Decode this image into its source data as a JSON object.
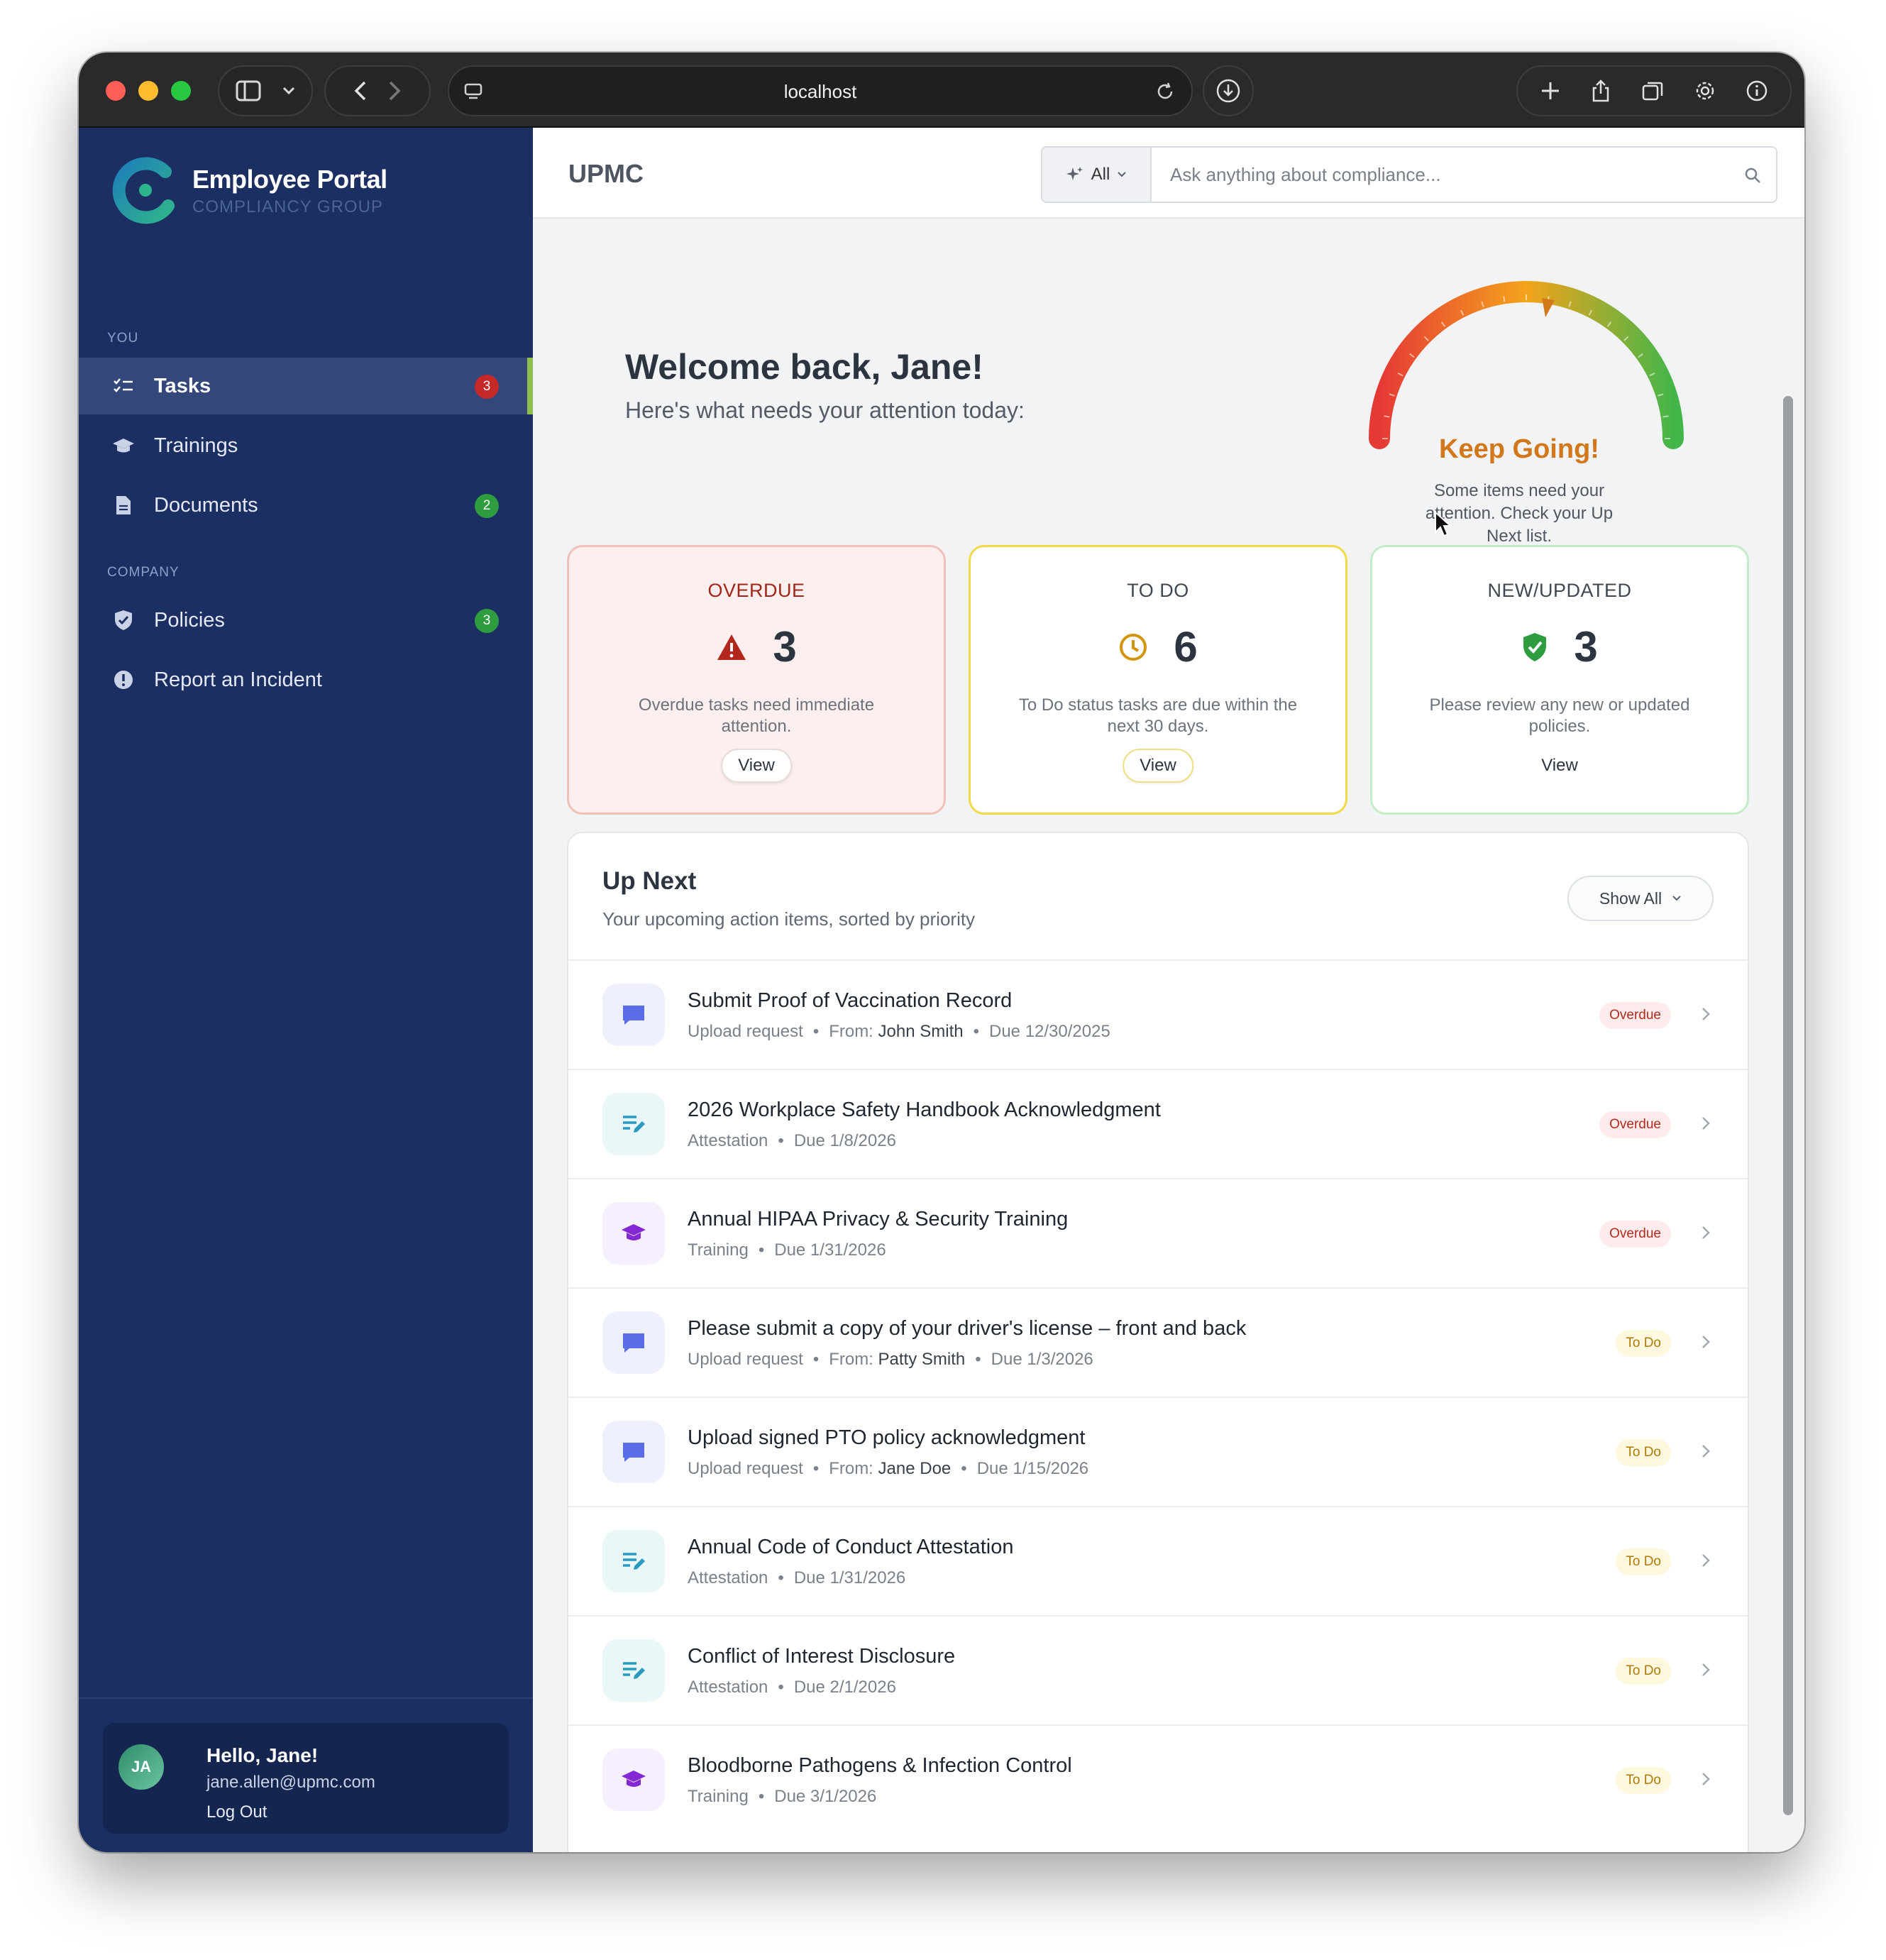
{
  "browser": {
    "url": "localhost"
  },
  "sidebar": {
    "brand_title": "Employee Portal",
    "brand_subtitle": "COMPLIANCY GROUP",
    "section_you": "YOU",
    "section_company": "COMPANY",
    "items": [
      {
        "label": "Tasks",
        "icon": "task-list-icon",
        "badge": "3",
        "active": true
      },
      {
        "label": "Trainings",
        "icon": "graduation-cap-icon",
        "badge": ""
      },
      {
        "label": "Documents",
        "icon": "document-icon",
        "badge": "2"
      },
      {
        "label": "Policies",
        "icon": "shield-check-icon",
        "badge": "3"
      },
      {
        "label": "Report an Incident",
        "icon": "exclamation-circle-icon",
        "badge": ""
      }
    ],
    "user": {
      "initials": "JA",
      "greeting": "Hello, Jane!",
      "email": "jane.allen@upmc.com",
      "logout_label": "Log Out"
    }
  },
  "header": {
    "org_name": "UPMC",
    "search_scope": "All",
    "search_placeholder": "Ask anything about compliance..."
  },
  "welcome": {
    "title": "Welcome back, Jane!",
    "subtitle": "Here's what needs your attention today:"
  },
  "gauge": {
    "title": "Keep Going!",
    "message": "Some items need your attention. Check your Up Next list.",
    "level": 0.55,
    "colors": [
      "#e53935",
      "#f4a31b",
      "#43b649"
    ]
  },
  "stats": [
    {
      "label": "OVERDUE",
      "count": "3",
      "icon": "warning-triangle-icon",
      "description": "Overdue tasks need immediate attention.",
      "view_label": "View",
      "color": "#b3261e"
    },
    {
      "label": "TO DO",
      "count": "6",
      "icon": "clock-icon",
      "description": "To Do status tasks are due within the next 30 days.",
      "view_label": "View",
      "color": "#d1940a"
    },
    {
      "label": "NEW/UPDATED",
      "count": "3",
      "icon": "shield-check-icon",
      "description": "Please review any new or updated policies.",
      "view_label": "View",
      "color": "#2e9c3f"
    }
  ],
  "upnext": {
    "title": "Up Next",
    "subtitle": "Your upcoming action items, sorted by priority",
    "filter_label": "Show All",
    "tasks": [
      {
        "title": "Submit Proof of Vaccination Record",
        "type": "Upload request",
        "from_label": "From:",
        "from": "John Smith",
        "due": "Due 12/30/2025",
        "status": "Overdue",
        "icon": "chat-bubble-icon"
      },
      {
        "title": "2026 Workplace Safety Handbook Acknowledgment",
        "type": "Attestation",
        "from_label": "",
        "from": "",
        "due": "Due 1/8/2026",
        "status": "Overdue",
        "icon": "edit-lines-icon"
      },
      {
        "title": "Annual HIPAA Privacy & Security Training",
        "type": "Training",
        "from_label": "",
        "from": "",
        "due": "Due 1/31/2026",
        "status": "Overdue",
        "icon": "graduation-cap-icon"
      },
      {
        "title": "Please submit a copy of your driver's license – front and back",
        "type": "Upload request",
        "from_label": "From:",
        "from": "Patty Smith",
        "due": "Due 1/3/2026",
        "status": "To Do",
        "icon": "chat-bubble-icon"
      },
      {
        "title": "Upload signed PTO policy acknowledgment",
        "type": "Upload request",
        "from_label": "From:",
        "from": "Jane Doe",
        "due": "Due 1/15/2026",
        "status": "To Do",
        "icon": "chat-bubble-icon"
      },
      {
        "title": "Annual Code of Conduct Attestation",
        "type": "Attestation",
        "from_label": "",
        "from": "",
        "due": "Due 1/31/2026",
        "status": "To Do",
        "icon": "edit-lines-icon"
      },
      {
        "title": "Conflict of Interest Disclosure",
        "type": "Attestation",
        "from_label": "",
        "from": "",
        "due": "Due 2/1/2026",
        "status": "To Do",
        "icon": "edit-lines-icon"
      },
      {
        "title": "Bloodborne Pathogens & Infection Control",
        "type": "Training",
        "from_label": "",
        "from": "",
        "due": "Due 3/1/2026",
        "status": "To Do",
        "icon": "graduation-cap-icon"
      }
    ]
  }
}
